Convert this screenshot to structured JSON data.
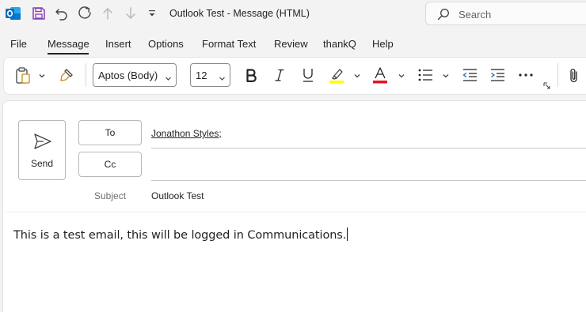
{
  "window": {
    "title": "Outlook Test  -  Message (HTML)",
    "search_placeholder": "Search"
  },
  "tabs": [
    {
      "label": "File"
    },
    {
      "label": "Message"
    },
    {
      "label": "Insert"
    },
    {
      "label": "Options"
    },
    {
      "label": "Format Text"
    },
    {
      "label": "Review"
    },
    {
      "label": "thankQ"
    },
    {
      "label": "Help"
    }
  ],
  "ribbon": {
    "font_name": "Aptos (Body)",
    "font_size": "12",
    "highlight_color": "#ffff00",
    "font_color": "#e81123"
  },
  "compose": {
    "send_label": "Send",
    "to_label": "To",
    "cc_label": "Cc",
    "to_value": "Jonathon Styles;",
    "cc_value": "",
    "subject_label": "Subject",
    "subject_value": "Outlook Test",
    "body": "This is a test email, this will be logged in Communications."
  },
  "colors": {
    "accent": "#0f6cbd",
    "save_icon": "#8a3ab9"
  }
}
